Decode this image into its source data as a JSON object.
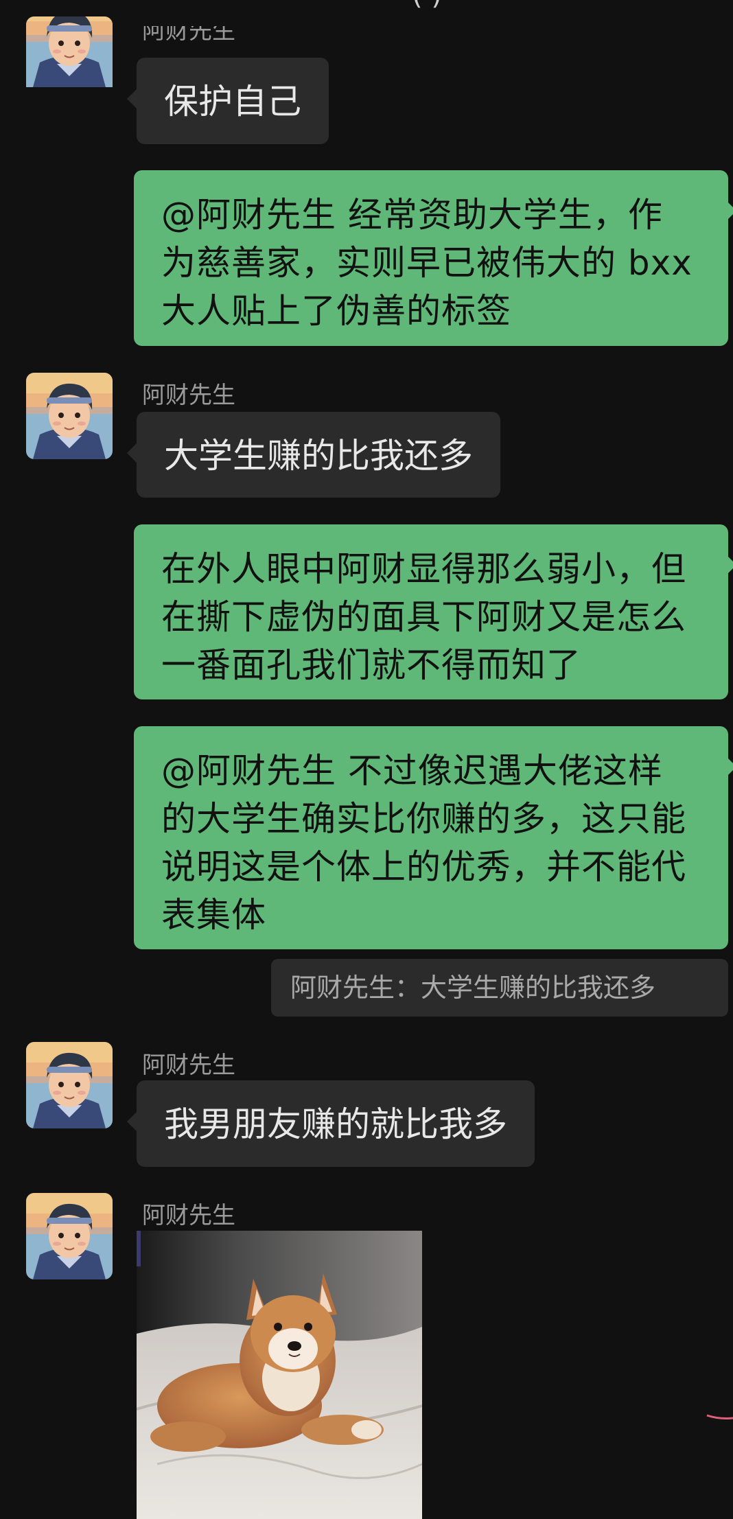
{
  "header": {
    "partial_glyphs": "( )"
  },
  "messages": [
    {
      "type": "incoming",
      "sender": "阿财先生",
      "lines": [
        "保护自己"
      ],
      "avatar_icon": "cartoon-boy-avatar"
    },
    {
      "type": "outgoing",
      "lines": [
        "@阿财先生  经常资助大学生，作",
        "为慈善家，实则早已被伟大的 bxx",
        "大人贴上了伪善的标签"
      ]
    },
    {
      "type": "incoming",
      "sender": "阿财先生",
      "lines": [
        "大学生赚的比我还多"
      ],
      "avatar_icon": "cartoon-boy-avatar"
    },
    {
      "type": "outgoing",
      "lines": [
        "在外人眼中阿财显得那么弱小，但",
        "在撕下虚伪的面具下阿财又是怎么",
        "一番面孔我们就不得而知了"
      ]
    },
    {
      "type": "outgoing",
      "lines": [
        "@阿财先生  不过像迟遇大佬这样",
        "的大学生确实比你赚的多，这只能",
        "说明这是个体上的优秀，并不能代",
        "表集体"
      ]
    },
    {
      "type": "quote",
      "text": "阿财先生：大学生赚的比我还多"
    },
    {
      "type": "incoming",
      "sender": "阿财先生",
      "lines": [
        "我男朋友赚的就比我多"
      ],
      "avatar_icon": "cartoon-boy-avatar"
    },
    {
      "type": "incoming-image",
      "sender": "阿财先生",
      "image_icon": "shiba-dog-photo",
      "avatar_icon": "cartoon-boy-avatar"
    }
  ],
  "colors": {
    "background": "#111111",
    "incoming_bubble": "#2b2b2b",
    "outgoing_bubble": "#5fb877",
    "sender_text": "#9a9a9a",
    "quote_text": "#a9a9a9"
  }
}
